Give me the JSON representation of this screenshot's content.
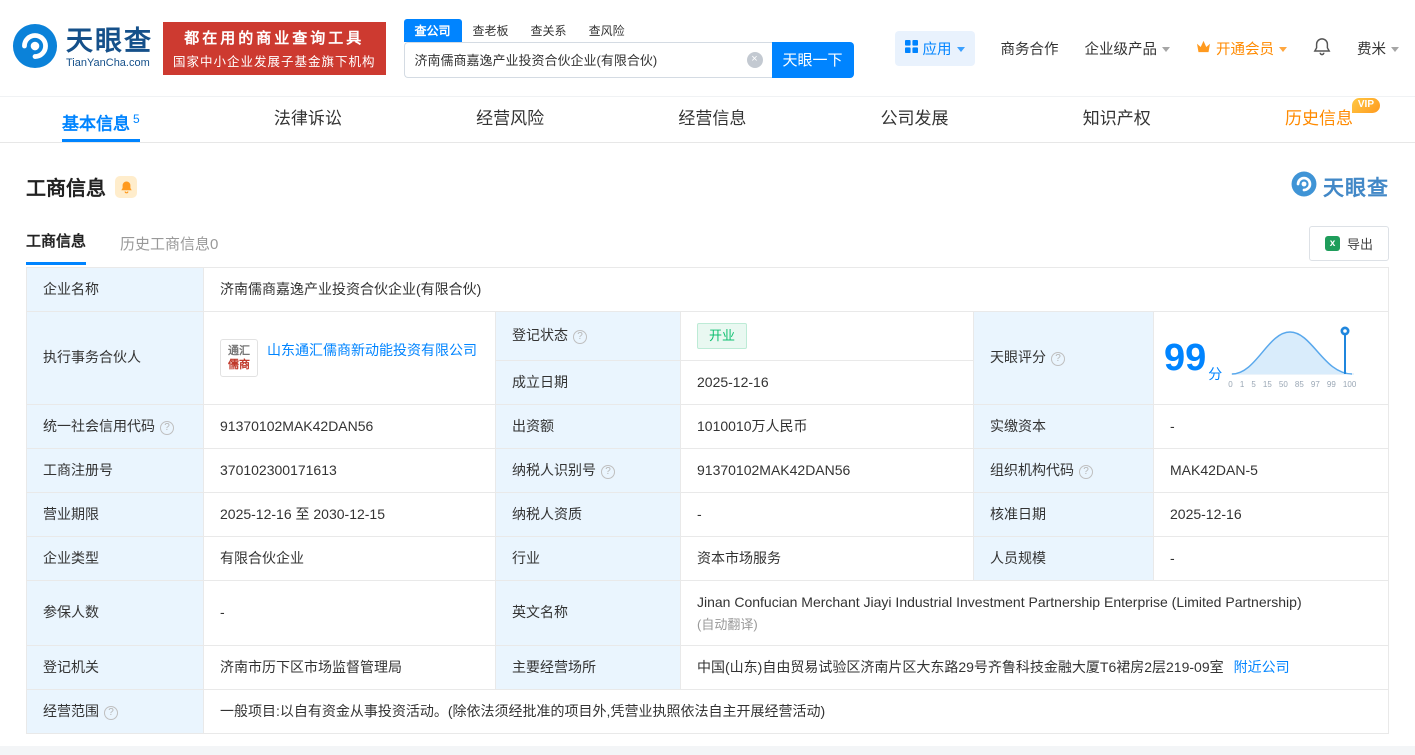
{
  "brand": {
    "name": "天眼查",
    "domain": "TianYanCha.com",
    "primary_color": "#0084ff",
    "orange": "#ff8a00",
    "red": "#cd3a30",
    "green": "#0fbf71"
  },
  "topbar": {
    "banner": {
      "line1": "都在用的商业查询工具",
      "line2": "国家中小企业发展子基金旗下机构"
    },
    "search": {
      "tabs": [
        {
          "label": "查公司",
          "active": true
        },
        {
          "label": "查老板",
          "active": false
        },
        {
          "label": "查关系",
          "active": false
        },
        {
          "label": "查风险",
          "active": false
        }
      ],
      "value": "济南儒商嘉逸产业投资合伙企业(有限合伙)",
      "button": "天眼一下"
    },
    "nav": {
      "apps": "应用",
      "cooperation": "商务合作",
      "enterprise_products": "企业级产品",
      "membership": "开通会员",
      "username": "费米"
    }
  },
  "nav_tabs": [
    {
      "label": "基本信息",
      "badge": "5",
      "active": true
    },
    {
      "label": "法律诉讼"
    },
    {
      "label": "经营风险"
    },
    {
      "label": "经营信息"
    },
    {
      "label": "公司发展"
    },
    {
      "label": "知识产权"
    },
    {
      "label": "历史信息",
      "tag": "VIP"
    }
  ],
  "section": {
    "title": "工商信息",
    "logo_text": "天眼查",
    "sub_tabs": [
      {
        "label": "工商信息",
        "active": true
      },
      {
        "label": "历史工商信息0",
        "active": false
      }
    ],
    "export": "导出"
  },
  "info": {
    "company_name": {
      "label": "企业名称",
      "value": "济南儒商嘉逸产业投资合伙企业(有限合伙)"
    },
    "partner": {
      "label": "执行事务合伙人",
      "value": "山东通汇儒商新动能投资有限公司",
      "logo1": "通汇",
      "logo2": "儒商"
    },
    "status": {
      "label": "登记状态",
      "value": "开业"
    },
    "established": {
      "label": "成立日期",
      "value": "2025-12-16"
    },
    "score": {
      "label": "天眼评分",
      "value": "99",
      "unit": "分",
      "ticks": [
        "0",
        "1",
        "5",
        "15",
        "50",
        "85",
        "97",
        "99",
        "100"
      ]
    },
    "credit_code": {
      "label": "统一社会信用代码",
      "value": "91370102MAK42DAN56"
    },
    "capital": {
      "label": "出资额",
      "value": "1010010万人民币"
    },
    "paid_capital": {
      "label": "实缴资本",
      "value": "-"
    },
    "reg_no": {
      "label": "工商注册号",
      "value": "370102300171613"
    },
    "taxpayer_no": {
      "label": "纳税人识别号",
      "value": "91370102MAK42DAN56"
    },
    "org_code": {
      "label": "组织机构代码",
      "value": "MAK42DAN-5"
    },
    "term": {
      "label": "营业期限",
      "value": "2025-12-16 至 2030-12-15"
    },
    "taxpayer_quality": {
      "label": "纳税人资质",
      "value": "-"
    },
    "approve_date": {
      "label": "核准日期",
      "value": "2025-12-16"
    },
    "type": {
      "label": "企业类型",
      "value": "有限合伙企业"
    },
    "industry": {
      "label": "行业",
      "value": "资本市场服务"
    },
    "staff": {
      "label": "人员规模",
      "value": "-"
    },
    "insured": {
      "label": "参保人数",
      "value": "-"
    },
    "english": {
      "label": "英文名称",
      "value": "Jinan Confucian Merchant Jiayi Industrial Investment Partnership Enterprise (Limited Partnership)",
      "note": "(自动翻译)"
    },
    "authority": {
      "label": "登记机关",
      "value": "济南市历下区市场监督管理局"
    },
    "address": {
      "label": "主要经营场所",
      "value": "中国(山东)自由贸易试验区济南片区大东路29号齐鲁科技金融大厦T6裙房2层219-09室",
      "link": "附近公司"
    },
    "scope": {
      "label": "经营范围",
      "value": "一般项目:以自有资金从事投资活动。(除依法须经批准的项目外,凭营业执照依法自主开展经营活动)"
    }
  }
}
